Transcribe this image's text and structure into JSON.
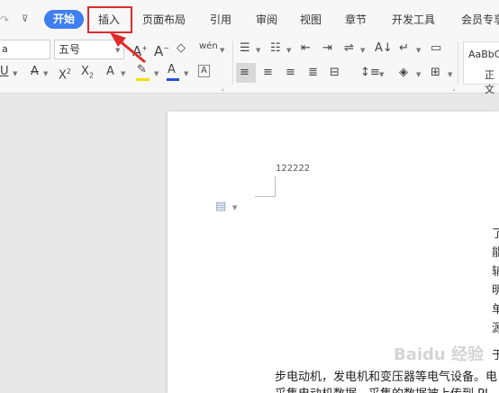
{
  "tabs": {
    "home": "开始",
    "insert": "插入",
    "page_layout": "页面布局",
    "references": "引用",
    "review": "审阅",
    "view": "视图",
    "section": "章节",
    "developer": "开发工具",
    "member": "会员专享"
  },
  "toolbar": {
    "font_name": "a",
    "font_size": "五号",
    "styles_preview": "AaBbC",
    "styles_label": "正文"
  },
  "document": {
    "header_number": "122222",
    "side_chars": [
      "了",
      "能",
      "辅",
      "明",
      "单",
      "源",
      "于"
    ],
    "body_line_1": "步电动机，发电机和变压器等电气设备。电",
    "body_line_2": "采集电动机数据，采集的数据被上传到 PL"
  },
  "watermark": "Baidu 经验",
  "colors": {
    "accent": "#3f7ef1",
    "highlight_box": "#e02b2b",
    "font_color_bar": "#2050d8",
    "highlight_color_bar": "#f5e000"
  }
}
